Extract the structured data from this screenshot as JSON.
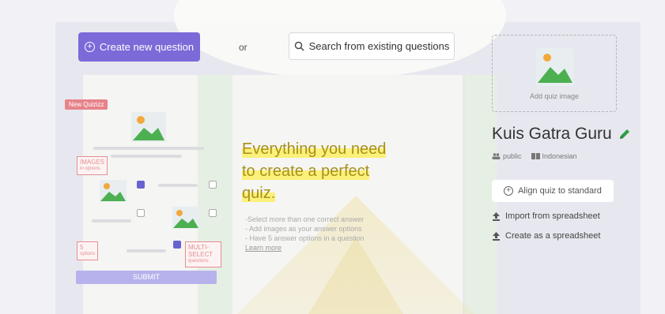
{
  "toolbar": {
    "create_label": "Create new question",
    "or_label": "or",
    "search_label": "Search from existing questions"
  },
  "quiz_image": {
    "label": "Add quiz image"
  },
  "quiz": {
    "title": "Kuis Gatra Guru",
    "visibility": "public",
    "language": "Indonesian"
  },
  "actions": {
    "align_label": "Align quiz to standard",
    "import_label": "Import from spreadsheet",
    "create_sheet_label": "Create as a spreadsheet"
  },
  "promo": {
    "headline_1": "Everything you need",
    "headline_2": "to create a perfect",
    "headline_3": "quiz.",
    "features": [
      "-Select more than one correct answer",
      "- Add images as your answer options",
      "- Have 5 answer options in a question"
    ],
    "learn_more": "Learn more"
  },
  "illustration": {
    "badge": "New Quizizz",
    "tag_images": "IMAGES",
    "tag_images_sub": "in options",
    "tag_five": "5",
    "tag_five_sub": "options",
    "tag_multi": "MULTI-SELECT",
    "tag_multi_sub": "questions",
    "submit": "SUBMIT"
  },
  "colors": {
    "primary": "#7b6ad8",
    "edit_green": "#2f9e44",
    "headline": "#a8901a",
    "highlight": "#fbf07a"
  }
}
